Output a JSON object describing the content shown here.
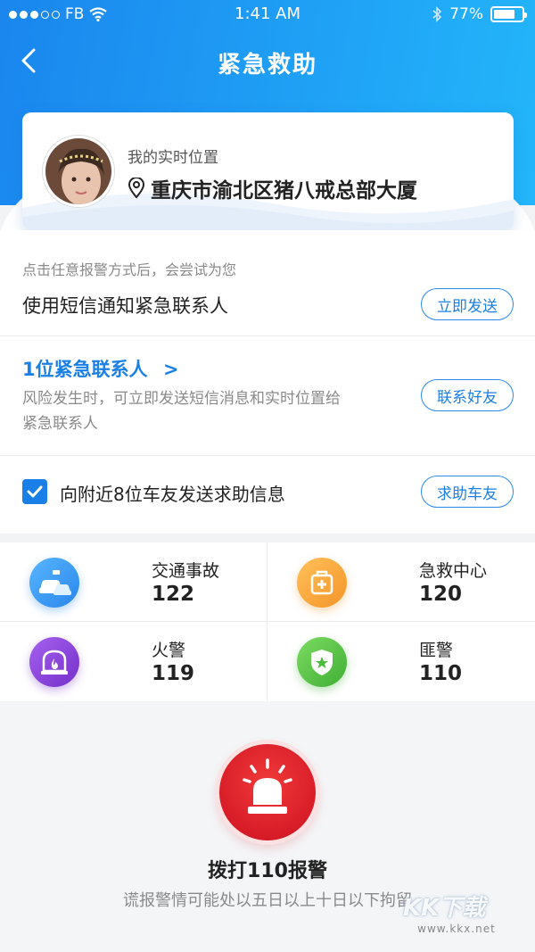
{
  "status_bar": {
    "carrier": "FB",
    "time": "1:41 AM",
    "battery": "77%",
    "battery_level": 0.77
  },
  "nav": {
    "title": "紧急救助"
  },
  "location": {
    "label": "我的实时位置",
    "address": "重庆市渝北区猪八戒总部大厦"
  },
  "sms": {
    "hint": "点击任意报警方式后，会尝试为您",
    "title": "使用短信通知紧急联系人",
    "button": "立即发送"
  },
  "contacts": {
    "link": "1位紧急联系人",
    "arrow": ">",
    "desc": "风险发生时，可立即发送短信消息和实时位置给紧急联系人",
    "button": "联系好友"
  },
  "nearby": {
    "checked": true,
    "text": "向附近8位车友发送求助信息",
    "button": "求助车友"
  },
  "services": [
    {
      "name": "交通事故",
      "number": "122",
      "icon": "car-accident-icon",
      "color": "#3a9cf2"
    },
    {
      "name": "急救中心",
      "number": "120",
      "icon": "first-aid-icon",
      "color": "#f6a63a"
    },
    {
      "name": "火警",
      "number": "119",
      "icon": "fire-alarm-icon",
      "color": "#8e4bdc"
    },
    {
      "name": "匪警",
      "number": "110",
      "icon": "police-shield-icon",
      "color": "#56c445"
    }
  ],
  "call": {
    "label": "拨打110报警",
    "warning": "谎报警情可能处以五日以上十日以下拘留"
  },
  "watermark": {
    "text": "KK下载",
    "url": "www.kkx.net"
  }
}
